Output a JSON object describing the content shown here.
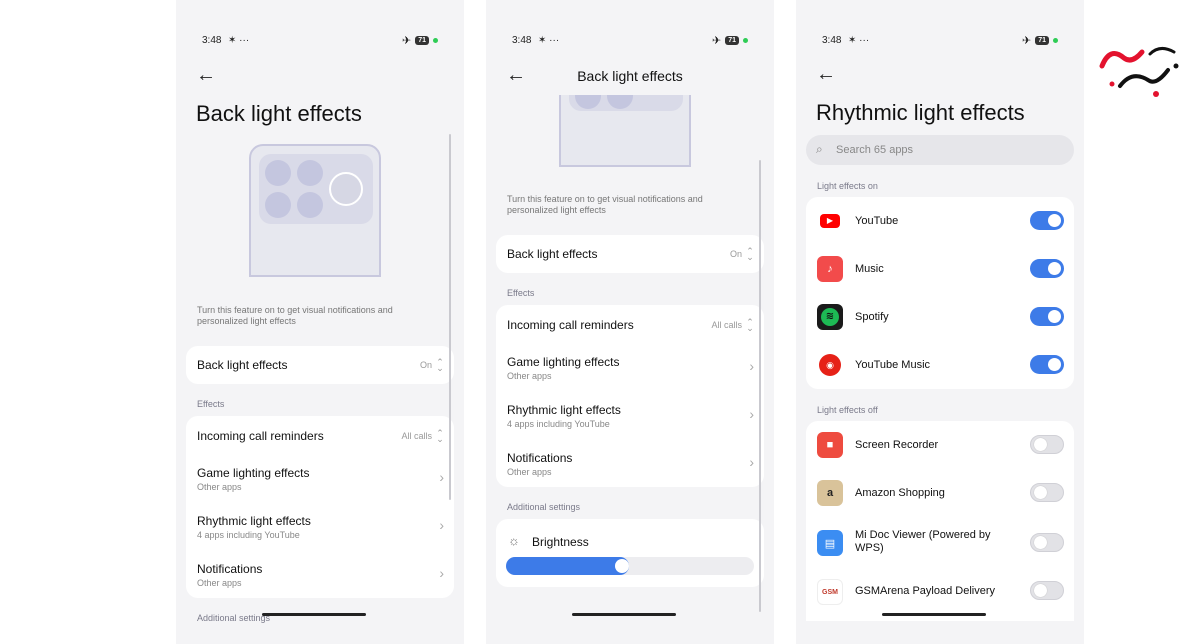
{
  "status": {
    "time": "3:48",
    "extra": "✶ ···",
    "battery": "71"
  },
  "screen1": {
    "title": "Back light effects",
    "description": "Turn this feature on to get visual notifications and personalized light effects",
    "main_toggle": {
      "label": "Back light effects",
      "value": "On"
    },
    "effects_label": "Effects",
    "items": [
      {
        "title": "Incoming call reminders",
        "value": "All calls"
      },
      {
        "title": "Game lighting effects",
        "subtitle": "Other apps"
      },
      {
        "title": "Rhythmic light effects",
        "subtitle": "4 apps including YouTube"
      },
      {
        "title": "Notifications",
        "subtitle": "Other apps"
      }
    ],
    "additional_label": "Additional settings"
  },
  "screen2": {
    "title": "Back light effects",
    "description": "Turn this feature on to get visual notifications and personalized light effects",
    "main_toggle": {
      "label": "Back light effects",
      "value": "On"
    },
    "effects_label": "Effects",
    "items": [
      {
        "title": "Incoming call reminders",
        "value": "All calls"
      },
      {
        "title": "Game lighting effects",
        "subtitle": "Other apps"
      },
      {
        "title": "Rhythmic light effects",
        "subtitle": "4 apps including YouTube"
      },
      {
        "title": "Notifications",
        "subtitle": "Other apps"
      }
    ],
    "additional_label": "Additional settings",
    "brightness": {
      "label": "Brightness",
      "level": 0.46
    }
  },
  "screen3": {
    "title": "Rhythmic light effects",
    "search_placeholder": "Search 65 apps",
    "on_label": "Light effects on",
    "off_label": "Light effects off",
    "apps_on": [
      {
        "name": "YouTube",
        "icon": "youtube-icon",
        "color": "#ff0000",
        "enabled": true
      },
      {
        "name": "Music",
        "icon": "music-icon",
        "color": "#f24b4b",
        "enabled": true
      },
      {
        "name": "Spotify",
        "icon": "spotify-icon",
        "color": "#1a1a1a",
        "enabled": true
      },
      {
        "name": "YouTube Music",
        "icon": "youtube-music-icon",
        "color": "#e62117",
        "enabled": true
      }
    ],
    "apps_off": [
      {
        "name": "Screen Recorder",
        "icon": "screen-recorder-icon",
        "color": "#ee4b3f",
        "enabled": false
      },
      {
        "name": "Amazon Shopping",
        "icon": "amazon-icon",
        "color": "#d9c39a",
        "enabled": false
      },
      {
        "name": "Mi Doc Viewer (Powered by WPS)",
        "icon": "document-icon",
        "color": "#3b8df2",
        "enabled": false
      },
      {
        "name": "GSMArena Payload Delivery",
        "icon": "gsmarena-icon",
        "color": "#ffffff",
        "enabled": false
      }
    ]
  },
  "theme": {
    "accent": "#3d7be8",
    "background": "#f4f4f6"
  }
}
